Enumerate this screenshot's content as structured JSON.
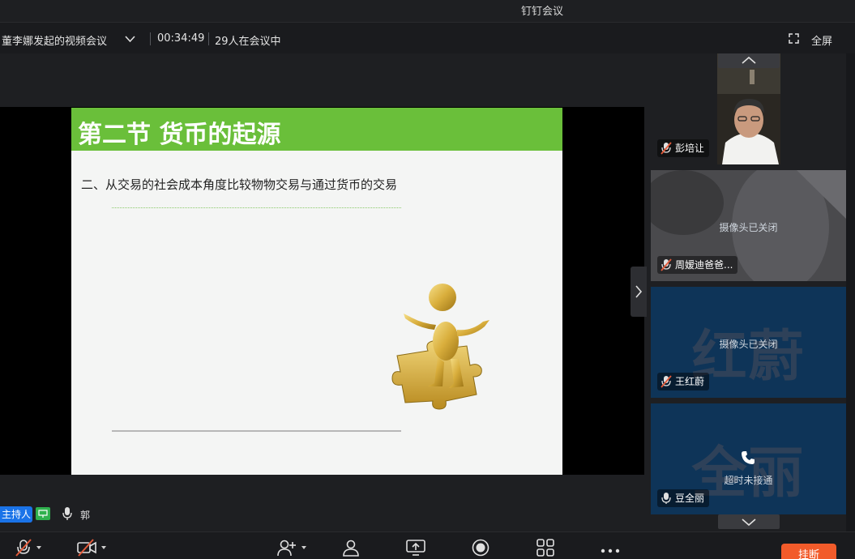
{
  "app": {
    "title": "钉钉会议"
  },
  "meeting": {
    "title": "董李娜发起的视频会议",
    "duration": "00:34:49",
    "participants": "29人在会议中",
    "fullscreen_label": "全屏"
  },
  "slide": {
    "title": "第二节 货币的起源",
    "subtitle": "二、从交易的社会成本角度比较物物交易与通过货币的交易"
  },
  "presenter": {
    "host_badge": "主持人",
    "speaker_name": "郭"
  },
  "participants_list": [
    {
      "name": "彭培让",
      "status": "",
      "avatar_text": ""
    },
    {
      "name": "周嫒迪爸爸...",
      "status": "摄像头已关闭",
      "avatar_text": ""
    },
    {
      "name": "王红蔚",
      "status": "摄像头已关闭",
      "avatar_text": "红蔚"
    },
    {
      "name": "豆全丽",
      "status": "超时未接通",
      "avatar_text": "全丽"
    }
  ],
  "toolbar": {
    "hangup_label": "挂断"
  },
  "colors": {
    "slide_header": "#6abf3a",
    "host_badge": "#1a73e8",
    "hangup": "#f25b2a",
    "muted_mic": "#e35a3a",
    "tile_blue": "#0e3458"
  }
}
